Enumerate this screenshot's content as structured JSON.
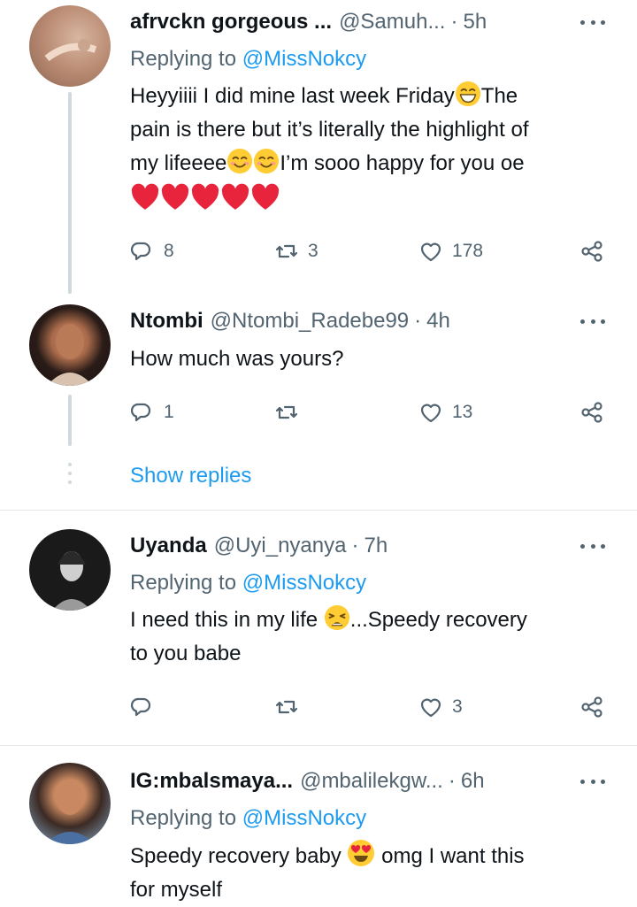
{
  "tweets": [
    {
      "name": "afrvckn gorgeous ...",
      "handle": "@Samuh...",
      "time": "5h",
      "replying_prefix": "Replying to",
      "replying_to": "@MissNokcy",
      "lines": [
        "Heyyiiii I did mine last week Friday",
        "The",
        "pain is there but it’s literally the highlight of",
        "my lifeeee",
        "I’m sooo happy for you oe"
      ],
      "replies": "8",
      "retweets": "3",
      "likes": "178"
    },
    {
      "name": "Ntombi",
      "handle": "@Ntombi_Radebe99",
      "time": "4h",
      "text": "How much was yours?",
      "replies": "1",
      "retweets": "",
      "likes": "13"
    },
    {
      "name": "Uyanda",
      "handle": "@Uyi_nyanya",
      "time": "7h",
      "replying_prefix": "Replying to",
      "replying_to": "@MissNokcy",
      "lines": [
        "I need this in my life",
        "...Speedy recovery",
        "to you babe"
      ],
      "replies": "",
      "retweets": "",
      "likes": "3"
    },
    {
      "name": "IG:mbalsmaya...",
      "handle": "@mbalilekgw...",
      "time": "6h",
      "replying_prefix": "Replying to",
      "replying_to": "@MissNokcy",
      "lines": [
        "Speedy recovery baby",
        "omg I want this",
        "for myself"
      ]
    }
  ],
  "show_replies": "Show replies",
  "icons": {
    "reply": "reply-icon",
    "retweet": "retweet-icon",
    "like": "heart-icon",
    "share": "share-icon",
    "more": "more-icon",
    "emojis": [
      "grinning-sweat-emoji",
      "smiling-blush-emoji",
      "red-heart-emoji",
      "weary-emoji",
      "heart-eyes-emoji"
    ]
  },
  "colors": {
    "accent": "#1d9bf0",
    "secondary_text": "#536471",
    "text": "#0f1419",
    "heart": "#e8243c"
  }
}
